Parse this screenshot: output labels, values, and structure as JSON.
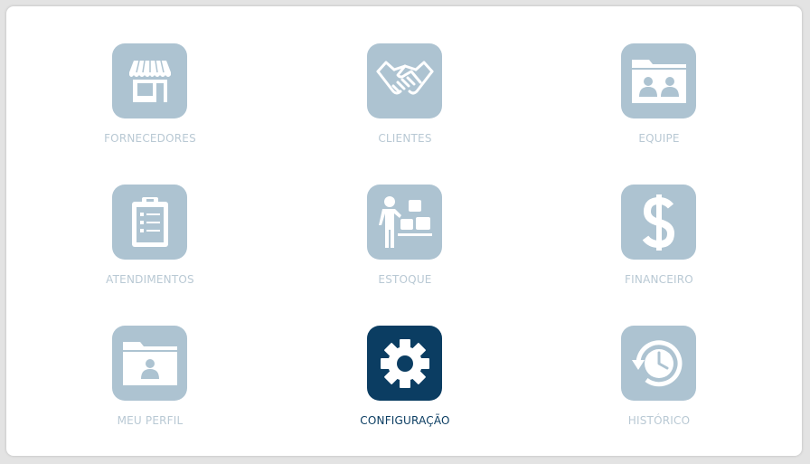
{
  "menu": {
    "items": [
      {
        "label": "FORNECEDORES",
        "icon": "store-icon",
        "active": false
      },
      {
        "label": "CLIENTES",
        "icon": "handshake-icon",
        "active": false
      },
      {
        "label": "EQUIPE",
        "icon": "team-folder-icon",
        "active": false
      },
      {
        "label": "ATENDIMENTOS",
        "icon": "clipboard-icon",
        "active": false
      },
      {
        "label": "ESTOQUE",
        "icon": "stock-person-boxes-icon",
        "active": false
      },
      {
        "label": "FINANCEIRO",
        "icon": "dollar-icon",
        "active": false
      },
      {
        "label": "MEU PERFIL",
        "icon": "profile-folder-icon",
        "active": false
      },
      {
        "label": "CONFIGURAÇÃO",
        "icon": "gear-icon",
        "active": true
      },
      {
        "label": "HISTÓRICO",
        "icon": "history-clock-icon",
        "active": false
      }
    ]
  },
  "colors": {
    "tile_bg": "#adc3d1",
    "tile_active_bg": "#0b3d62",
    "label": "#b9c9d4",
    "label_active": "#0b3d62"
  }
}
